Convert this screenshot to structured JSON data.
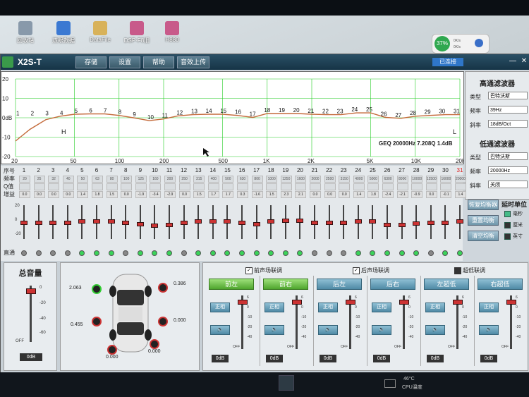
{
  "desktop": {
    "icons": [
      {
        "label": "回收站",
        "color": "#8899aa"
      },
      {
        "label": "双眼数据",
        "color": "#3b79d2"
      },
      {
        "label": "DataFile",
        "color": "#d8b25a"
      },
      {
        "label": "DSP-F8旧",
        "color": "#c85a8a"
      },
      {
        "label": "H880",
        "color": "#c85a8a"
      }
    ],
    "widget": {
      "percent": "37%",
      "up": "0K/s",
      "down": "0K/s"
    }
  },
  "app": {
    "title": "X2S-T",
    "menu": [
      "存储",
      "设置",
      "帮助",
      "音效上传"
    ],
    "status": "已连接",
    "win_min": "—",
    "win_close": "✕"
  },
  "graph": {
    "y_labels": [
      "20",
      "10",
      "0dB",
      "-10",
      "-20"
    ],
    "x_labels": [
      "20",
      "50",
      "100",
      "200",
      "500",
      "1K",
      "2K",
      "5K",
      "10K",
      "20K"
    ],
    "band_labels": [
      "1",
      "2",
      "3",
      "4",
      "5",
      "6",
      "7",
      "8",
      "9",
      "10",
      "11",
      "12",
      "13",
      "14",
      "15",
      "16",
      "17",
      "18",
      "19",
      "20",
      "21",
      "22",
      "23",
      "24",
      "25",
      "26",
      "27",
      "28",
      "29",
      "30",
      "31"
    ],
    "band_values_db": [
      0.5,
      0.5,
      0.5,
      0.8,
      1.8,
      2.0,
      2.0,
      1.2,
      0.0,
      -1.5,
      -0.6,
      1.0,
      1.6,
      1.8,
      1.8,
      1.2,
      0.2,
      2.2,
      2.2,
      2.2,
      1.8,
      1.6,
      1.6,
      2.5,
      2.5,
      0.2,
      -0.3,
      0.8,
      1.2,
      1.6,
      1.6
    ],
    "hp_marker": "H",
    "lp_marker": "L",
    "info": "GEQ 20000Hz 7.208Q 1.4dB"
  },
  "filters": {
    "hp_title": "高通滤波器",
    "hp_type_label": "类型",
    "hp_type": "巴特沃斯",
    "hp_freq_label": "频率",
    "hp_freq": "39Hz",
    "hp_slope_label": "斜率",
    "hp_slope": "18dB/Oct",
    "lp_title": "低通滤波器",
    "lp_type_label": "类型",
    "lp_type": "巴特沃斯",
    "lp_freq_label": "频率",
    "lp_freq": "20000Hz",
    "lp_slope_label": "斜率",
    "lp_slope": "关闭"
  },
  "eq": {
    "row_labels": [
      "序号",
      "频率",
      "Q值",
      "增益"
    ],
    "bands": [
      "1",
      "2",
      "3",
      "4",
      "5",
      "6",
      "7",
      "8",
      "9",
      "10",
      "11",
      "12",
      "13",
      "14",
      "15",
      "16",
      "17",
      "18",
      "19",
      "20",
      "21",
      "22",
      "23",
      "24",
      "25",
      "26",
      "27",
      "28",
      "29",
      "30",
      "31"
    ],
    "freqs": [
      "20",
      "25",
      "32",
      "40",
      "50",
      "63",
      "80",
      "100",
      "125",
      "160",
      "200",
      "250",
      "315",
      "400",
      "500",
      "630",
      "800",
      "1000",
      "1250",
      "1600",
      "2000",
      "2500",
      "3150",
      "4000",
      "5000",
      "6300",
      "8000",
      "10000",
      "12500",
      "16000",
      "20000"
    ],
    "gains": [
      "0.0",
      "0.0",
      "0.0",
      "0.0",
      "1.4",
      "1.8",
      "1.5",
      "0.0",
      "-1.9",
      "-3.4",
      "-2.9",
      "0.0",
      "1.5",
      "1.7",
      "1.7",
      "0.3",
      "-1.6",
      "1.5",
      "2.3",
      "2.1",
      "0.0",
      "0.0",
      "0.0",
      "1.4",
      "1.8",
      "-2.4",
      "-2.1",
      "-0.9",
      "0.0",
      "-0.1",
      "1.4"
    ],
    "scale": [
      "20",
      "0",
      "-20"
    ],
    "bypass_label": "直通",
    "active": [
      false,
      false,
      false,
      false,
      true,
      true,
      true,
      false,
      true,
      true,
      true,
      false,
      true,
      true,
      true,
      true,
      true,
      true,
      true,
      true,
      false,
      false,
      false,
      true,
      true,
      true,
      true,
      true,
      false,
      true,
      true
    ]
  },
  "eq_buttons": {
    "restore": "恢复均衡器",
    "reset": "重置均衡",
    "clear": "清空均衡",
    "delay_title": "延时单位",
    "delay_options": [
      "毫秒",
      "厘米",
      "英寸"
    ]
  },
  "linkage": {
    "front": "前声场联调",
    "rear": "后声场联调",
    "sub": "超低联调"
  },
  "master": {
    "title": "总音量",
    "scale": [
      "0",
      "-20",
      "-40",
      "-60",
      "OFF"
    ],
    "value": "0dB"
  },
  "car": {
    "delays": [
      "2.063",
      "0.386",
      "0.455",
      "0.000",
      "0.000",
      "0.000"
    ]
  },
  "channels": [
    {
      "name": "前左",
      "phase": "正相",
      "value": "0dB",
      "active": true
    },
    {
      "name": "前右",
      "phase": "正相",
      "value": "0dB",
      "active": true
    },
    {
      "name": "后左",
      "phase": "正相",
      "value": "0dB",
      "active": false
    },
    {
      "name": "后右",
      "phase": "正相",
      "value": "0dB",
      "active": false
    },
    {
      "name": "左超低",
      "phase": "正相",
      "value": "0dB",
      "active": false
    },
    {
      "name": "右超低",
      "phase": "正相",
      "value": "0dB",
      "active": false
    }
  ],
  "channel_scale": [
    "6",
    "0",
    "-10",
    "-20",
    "-40",
    "OFF"
  ],
  "taskbar": {
    "temp": "46°C",
    "cpu": "CPU温度"
  },
  "colors": {
    "accent_green": "#3bd35a",
    "eq_curve": "#c46a3a",
    "title_bar": "#163446"
  }
}
